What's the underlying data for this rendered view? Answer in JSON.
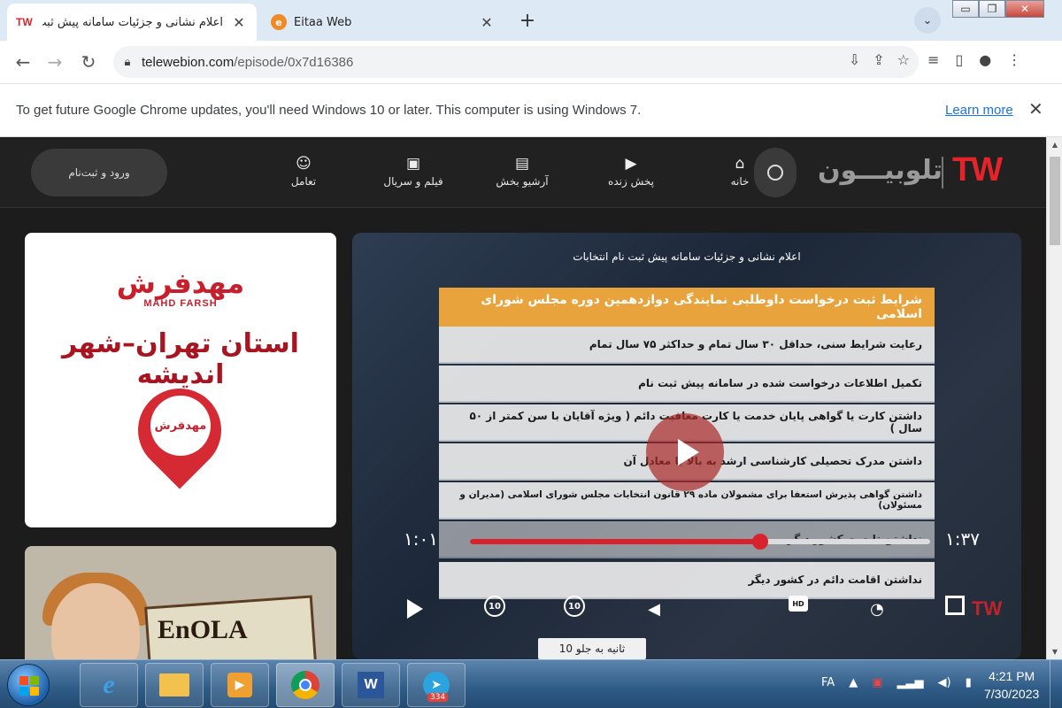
{
  "browser": {
    "tabs": [
      {
        "favicon": "TW",
        "title": "اعلام نشانی و جزئیات سامانه پیش ثبت نام",
        "active": true
      },
      {
        "favicon": "eitaa-icon",
        "title": "Eitaa Web",
        "active": false
      }
    ],
    "window_controls": {
      "minimize": "▭",
      "restore": "❐",
      "close": "✕"
    },
    "url_host": "telewebion.com",
    "url_path": "/episode/0x7d16386",
    "infobar": {
      "message": "To get future Google Chrome updates, you'll need Windows 10 or later. This computer is using Windows 7.",
      "link": "Learn more"
    }
  },
  "site": {
    "login_label": "ورود و ثبت‌نام",
    "nav": [
      {
        "label": "تعامل",
        "icon": "interact-icon"
      },
      {
        "label": "فیلم و سریال",
        "icon": "film-icon"
      },
      {
        "label": "آرشیو بخش",
        "icon": "archive-icon"
      },
      {
        "label": "پخش زنده",
        "icon": "live-tv-icon"
      },
      {
        "label": "خانه",
        "icon": "home-icon"
      }
    ],
    "logo_fa": "تلوبیـــون",
    "logo_tw": "TW"
  },
  "ads": {
    "ad1": {
      "brand_fa": "مهدفرش",
      "brand_en": "MAHD FARSH",
      "city": "استان تهران–شهر اندیشه",
      "pin_text": "مهدفرش"
    },
    "ad2": {
      "title": "EnOLA"
    }
  },
  "player": {
    "title": "اعلام نشانی و جزئیات سامانه پیش ثبت نام انتخابات",
    "card_header": "شرایط ثبت درخواست داوطلبی نمایندگی دوازدهمین دوره مجلس شورای اسلامی",
    "card_rows": [
      "رعایت شرایط سنی، حداقل ۳۰ سال تمام و حداکثر ۷۵ سال تمام",
      "تکمیل اطلاعات درخواست شده در سامانه پیش ثبت نام",
      "داشتن کارت یا گواهی پایان خدمت یا کارت معافیت دائم ( ویژه آقایان با سن کمتر از ۵۰ سال )",
      "داشتن مدرک تحصیلی کارشناسی ارشد به بالا یا معادل آن",
      "داشتن گواهی پذیرش استعفا برای مشمولان ماده ۲۹ قانون انتخابات مجلس شورای اسلامی (مدیران و مسئولان)",
      "نداشتن تابعیت کشور دیگر",
      "نداشتن اقامت دائم در کشور دیگر"
    ],
    "time_elapsed": "۱:۳۷",
    "time_remaining": "۱:۰۱",
    "progress": 0.63,
    "skip_back_label": "10",
    "skip_fwd_label": "10",
    "hd_label": "HD",
    "skip_tooltip": "10 ثانیه به جلو",
    "watermark": "TW"
  },
  "taskbar": {
    "apps": [
      "ie-icon",
      "explorer-icon",
      "media-player-icon",
      "chrome-icon",
      "word-icon",
      "telegram-icon"
    ],
    "telegram_badge": "334",
    "lang": "FA",
    "time": "4:21 PM",
    "date": "7/30/2023"
  }
}
